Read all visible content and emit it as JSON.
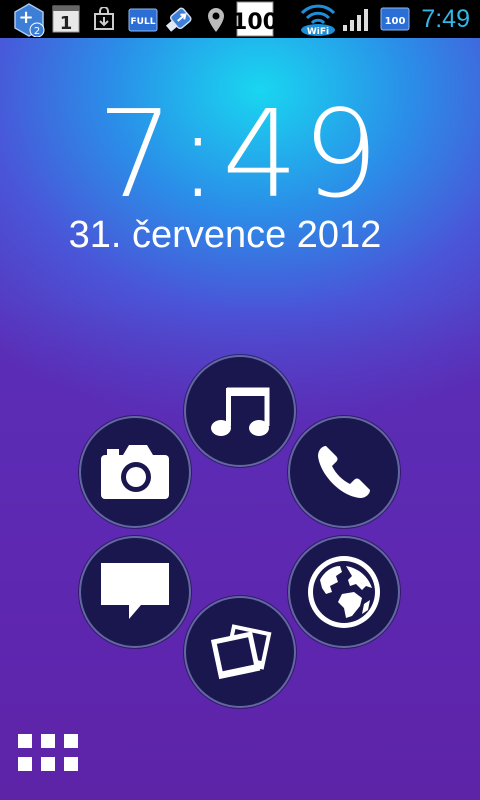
{
  "statusbar": {
    "notification_count": "2",
    "calendar_day": "1",
    "battery_text": "FULL",
    "badge_a": "100",
    "wifi_label": "WiFi",
    "battery_level": "100",
    "time": "7:49"
  },
  "lockscreen": {
    "clock": "7:49",
    "date": "31. července 2012"
  },
  "shortcuts": [
    "music",
    "phone",
    "browser",
    "gallery",
    "messaging",
    "camera"
  ],
  "colors": {
    "accent": "#33b5e5",
    "ring_fill": "#1a174e"
  }
}
